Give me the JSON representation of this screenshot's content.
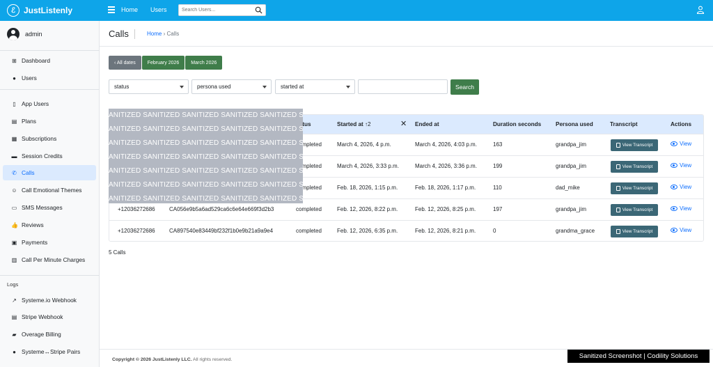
{
  "app": {
    "name": "JustListenly",
    "logo_letter": "ℰ"
  },
  "topnav": {
    "home": "Home",
    "users": "Users",
    "search_placeholder": "Search Users..."
  },
  "sidebar": {
    "user": "admin",
    "items": [
      {
        "label": "Dashboard",
        "icon": "grid-icon"
      },
      {
        "label": "Users",
        "icon": "person-icon"
      },
      {
        "label": "App Users",
        "icon": "phone-icon"
      },
      {
        "label": "Plans",
        "icon": "document-icon"
      },
      {
        "label": "Subscriptions",
        "icon": "calendar-icon"
      },
      {
        "label": "Session Credits",
        "icon": "card-icon"
      },
      {
        "label": "Calls",
        "icon": "phone-call-icon"
      },
      {
        "label": "Call Emotional Themes",
        "icon": "emoji-icon"
      },
      {
        "label": "SMS Messages",
        "icon": "chat-icon"
      },
      {
        "label": "Reviews",
        "icon": "thumbs-up-icon"
      },
      {
        "label": "Payments",
        "icon": "cash-icon"
      },
      {
        "label": "Call Per Minute Charges",
        "icon": "receipt-icon"
      }
    ],
    "logs_heading": "Logs",
    "log_items": [
      {
        "label": "Systeme.io Webhook",
        "icon": "external-link-icon"
      },
      {
        "label": "Stripe Webhook",
        "icon": "journal-icon"
      },
      {
        "label": "Overage Billing",
        "icon": "truck-icon"
      },
      {
        "label": "Systeme↔Stripe Pairs",
        "icon": "circle-icon"
      }
    ]
  },
  "page": {
    "title": "Calls",
    "breadcrumb_home": "Home",
    "breadcrumb_sep": "›",
    "breadcrumb_current": "Calls"
  },
  "date_filters": {
    "all": "‹ All dates",
    "months": [
      "February 2026",
      "March 2026"
    ]
  },
  "filters": {
    "status": "status",
    "persona": "persona used",
    "started": "started at",
    "search_btn": "Search",
    "text_value": ""
  },
  "table": {
    "columns": [
      "Status",
      "Started at",
      "Ended at",
      "Duration seconds",
      "Persona used",
      "Transcript",
      "Actions"
    ],
    "clear_sort": "✕",
    "sort_indicator": "↑2",
    "status_visible": "tatus",
    "transcript_btn": "View Transcript",
    "view_label": "View",
    "rows": [
      {
        "phone": "",
        "sid": "",
        "status": "completed",
        "started": "March 4, 2026, 4 p.m.",
        "ended": "March 4, 2026, 4:03 p.m.",
        "duration": "163",
        "persona": "grandpa_jim"
      },
      {
        "phone": "",
        "sid": "",
        "status": "completed",
        "started": "March 4, 2026, 3:33 p.m.",
        "ended": "March 4, 2026, 3:36 p.m.",
        "duration": "199",
        "persona": "grandpa_jim"
      },
      {
        "phone": "",
        "sid": "",
        "status": "completed",
        "started": "Feb. 18, 2026, 1:15 p.m.",
        "ended": "Feb. 18, 2026, 1:17 p.m.",
        "duration": "110",
        "persona": "dad_mike"
      },
      {
        "phone": "+12036272686",
        "sid": "CA056e9b5a6ad529ca6c6e64e669f3d2b3",
        "status": "completed",
        "started": "Feb. 12, 2026, 8:22 p.m.",
        "ended": "Feb. 12, 2026, 8:25 p.m.",
        "duration": "197",
        "persona": "grandpa_jim"
      },
      {
        "phone": "+12036272686",
        "sid": "CA897540e83449bf232f1b0e9b21a9a9e4",
        "status": "completed",
        "started": "Feb. 12, 2026, 6:35 p.m.",
        "ended": "Feb. 12, 2026, 8:21 p.m.",
        "duration": "0",
        "persona": "grandma_grace"
      }
    ]
  },
  "count_text": "5 Calls",
  "sanitized_line": "ANITIZED SANITIZED SANITIZED SANITIZED SANITIZED SANITIZED S",
  "footer": {
    "copyright": "Copyright © 2026 JustListenly LLC.",
    "rights": " All rights reserved."
  },
  "watermark": "Sanitized Screenshot | Codility Solutions",
  "colors": {
    "topbar": "#0ea5e9",
    "primary_green": "#3f7d4a",
    "link": "#0d6efd",
    "header_row": "#dbeafe"
  }
}
